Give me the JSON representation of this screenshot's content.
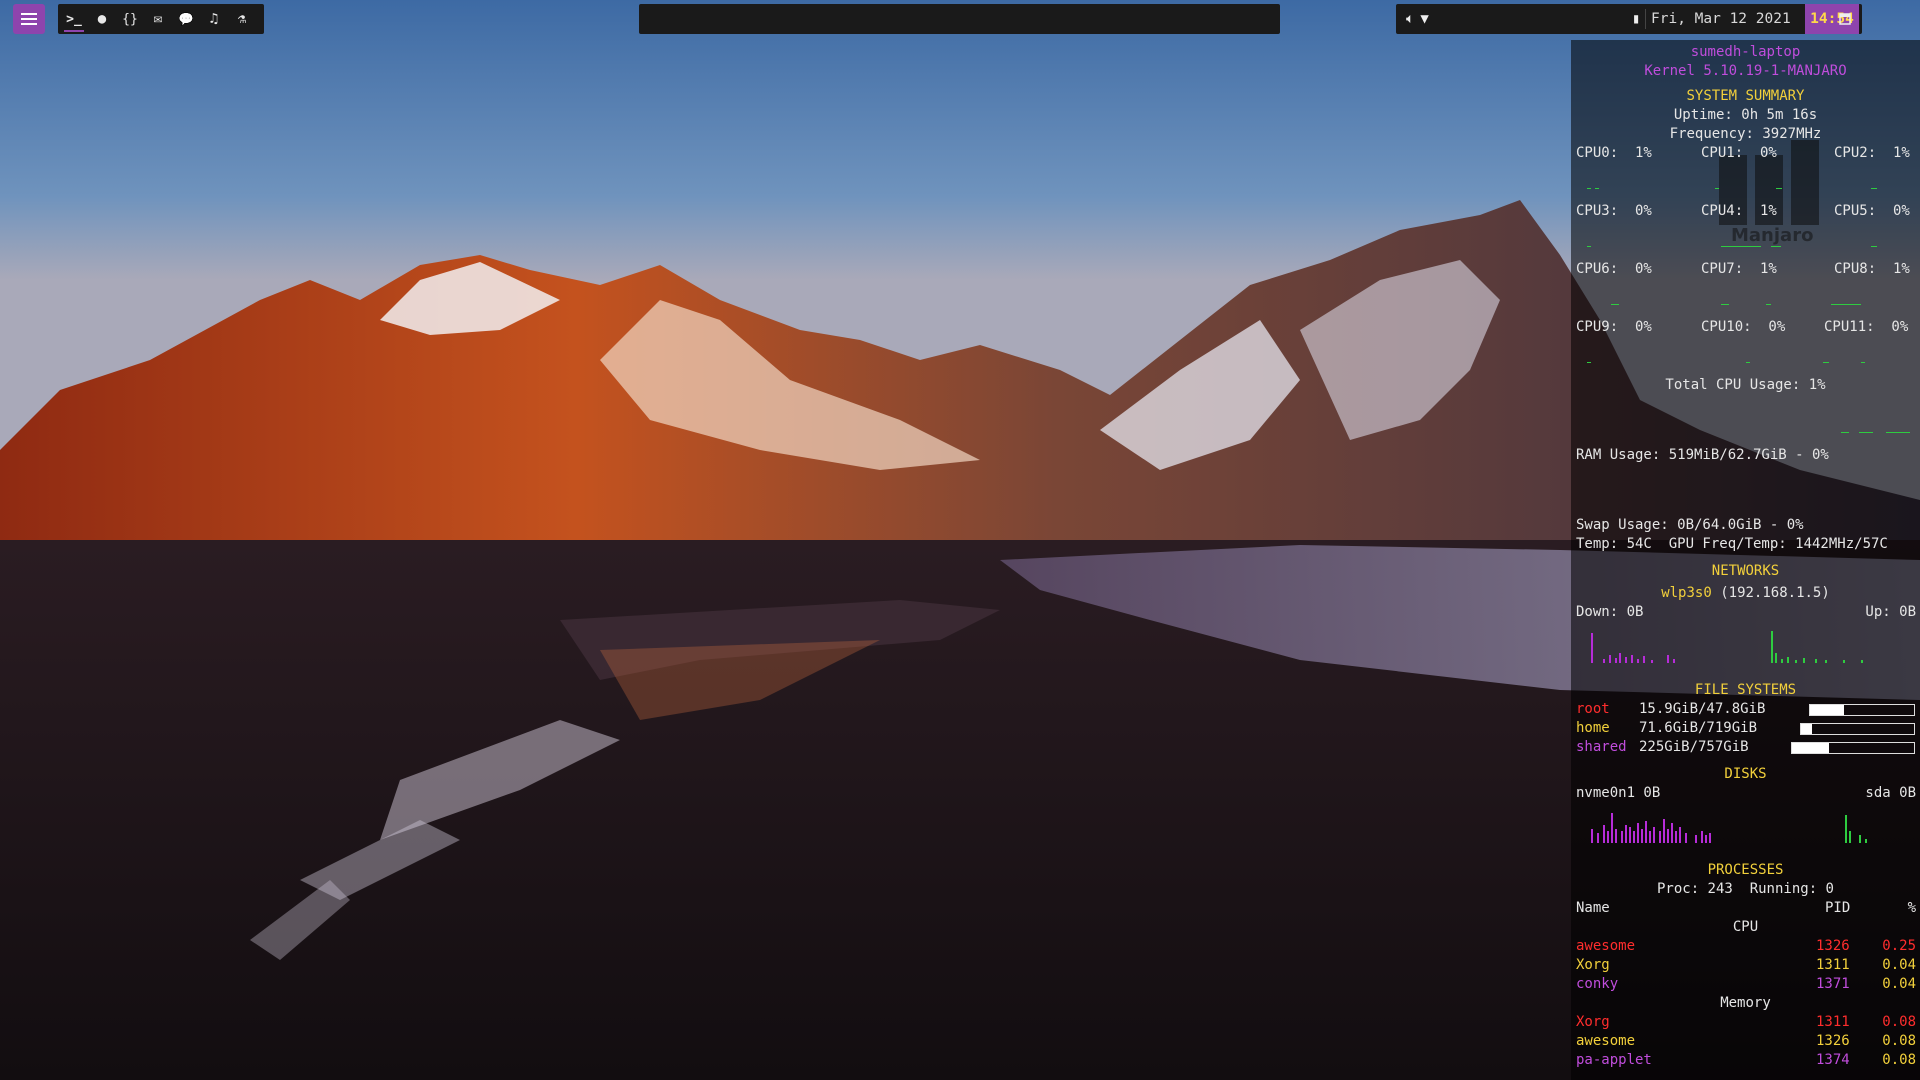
{
  "colors": {
    "accent": "#8e44ad",
    "clock_text": "#ffd84a",
    "heading": "#f2d03b",
    "host": "#c04ddc",
    "graph_green": "#2ecc40",
    "graph_purple": "#b62cd8"
  },
  "topbar": {
    "launcher_icon": "hamburger-menu-icon",
    "tags": [
      {
        "icon": "terminal-icon",
        "glyph": ">_"
      },
      {
        "icon": "firefox-icon",
        "glyph": "●"
      },
      {
        "icon": "code-braces-icon",
        "glyph": "{}"
      },
      {
        "icon": "mail-icon",
        "glyph": "✉"
      },
      {
        "icon": "chat-icon",
        "glyph": "💬"
      },
      {
        "icon": "music-icon",
        "glyph": "♫"
      },
      {
        "icon": "flask-icon",
        "glyph": "⚗"
      }
    ],
    "tray_icons": [
      "volume-icon",
      "wifi-icon",
      "battery-charging-icon"
    ],
    "date": "Fri, Mar 12 2021",
    "time": "14:54",
    "layout_icon": "layout-icon"
  },
  "conky": {
    "hostname": "sumedh-laptop",
    "kernel": "Kernel 5.10.19-1-MANJARO",
    "system_summary": "SYSTEM SUMMARY",
    "uptime": "Uptime: 0h 5m 16s",
    "frequency": "Frequency: 3927MHz",
    "logo_text": "Manjaro",
    "cpus": [
      "CPU0:  1%",
      "CPU1:  0%",
      "CPU2:  1%",
      "CPU3:  0%",
      "CPU4:  1%",
      "CPU5:  0%",
      "CPU6:  0%",
      "CPU7:  1%",
      "CPU8:  1%",
      "CPU9:  0%",
      "CPU10:  0%",
      "CPU11:  0%"
    ],
    "total_cpu": "Total CPU Usage: 1%",
    "ram": "RAM Usage: 519MiB/62.7GiB - 0%",
    "swap": "Swap Usage: 0B/64.0GiB - 0%",
    "temp": "Temp: 54C  GPU Freq/Temp: 1442MHz/57C",
    "networks_heading": "NETWORKS",
    "iface_name": "wlp3s0",
    "iface_ip": "(192.168.1.5)",
    "down": "Down: 0B",
    "up": "Up: 0B",
    "fs_heading": "FILE SYSTEMS",
    "filesystems": [
      {
        "name": "root",
        "usage": "15.9GiB/47.8GiB",
        "fraction": 0.33
      },
      {
        "name": "home",
        "usage": "71.6GiB/719GiB",
        "fraction": 0.1
      },
      {
        "name": "shared",
        "usage": "225GiB/757GiB",
        "fraction": 0.3
      }
    ],
    "disks_heading": "DISKS",
    "disk1": "nvme0n1 0B",
    "disk2": "sda 0B",
    "processes_heading": "PROCESSES",
    "proc_summary": "Proc: 243  Running: 0",
    "col_name": "Name",
    "col_pid": "PID",
    "col_pct": "%",
    "cpu_label": "CPU",
    "cpu_procs": [
      {
        "name": "awesome",
        "pid": "1326",
        "pct": "0.25"
      },
      {
        "name": "Xorg",
        "pid": "1311",
        "pct": "0.04"
      },
      {
        "name": "conky",
        "pid": "1371",
        "pct": "0.04"
      }
    ],
    "mem_label": "Memory",
    "mem_procs": [
      {
        "name": "Xorg",
        "pid": "1311",
        "pct": "0.08"
      },
      {
        "name": "awesome",
        "pid": "1326",
        "pct": "0.08"
      },
      {
        "name": "pa-applet",
        "pid": "1374",
        "pct": "0.08"
      }
    ]
  }
}
